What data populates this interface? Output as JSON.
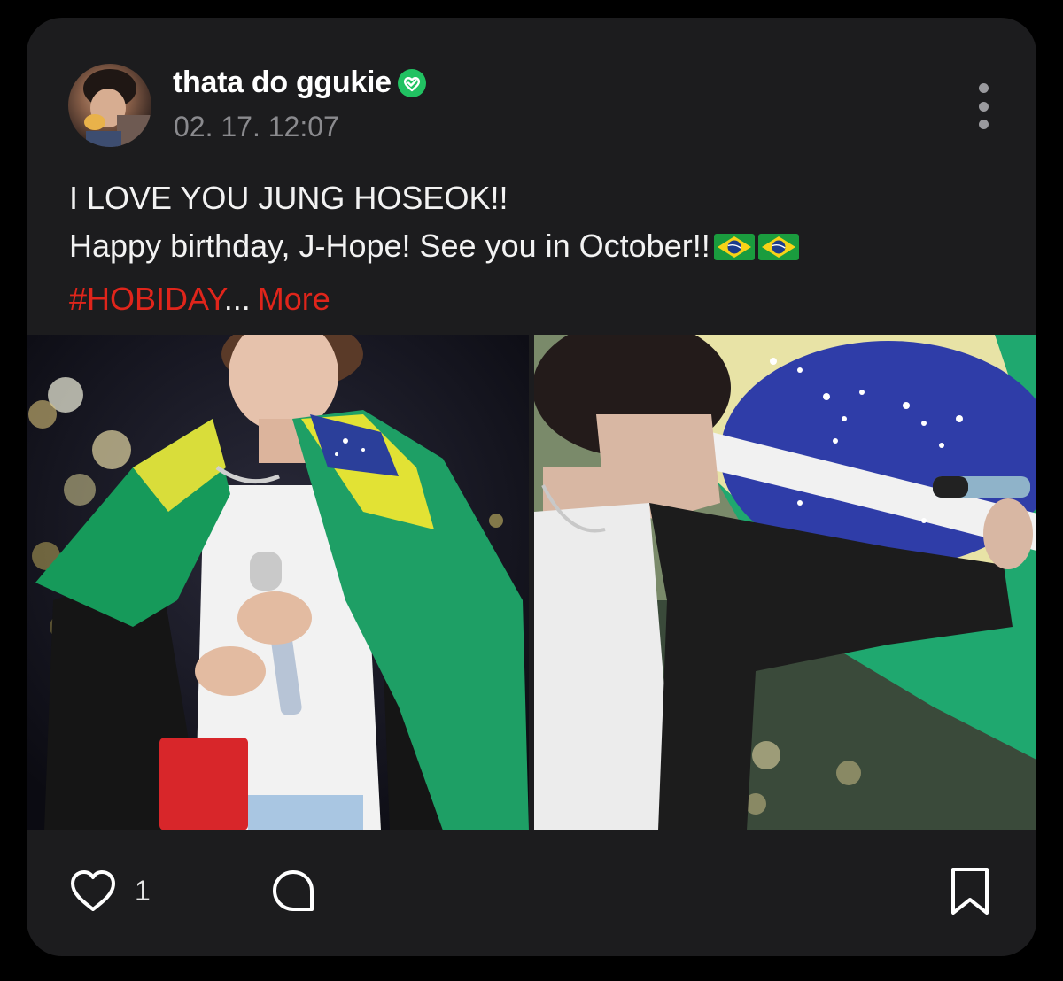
{
  "post": {
    "author": {
      "name": "thata do ggukie",
      "verified": true
    },
    "timestamp": "02. 17. 12:07",
    "text": {
      "line1": "I LOVE YOU JUNG HOSEOK!!",
      "line2": "Happy birthday, J-Hope! See you in October!!",
      "hashtag": "#HOBIDAY",
      "ellipsis": "...",
      "more_label": "More"
    },
    "images_count": 2
  },
  "actions": {
    "like_count": "1",
    "like_icon": "heart-icon",
    "comment_icon": "comment-icon",
    "save_icon": "bookmark-icon"
  },
  "colors": {
    "background": "#000000",
    "card": "#1c1c1e",
    "accent": "#e0251b",
    "muted": "#8a8a8e",
    "verified": "#21c262"
  }
}
